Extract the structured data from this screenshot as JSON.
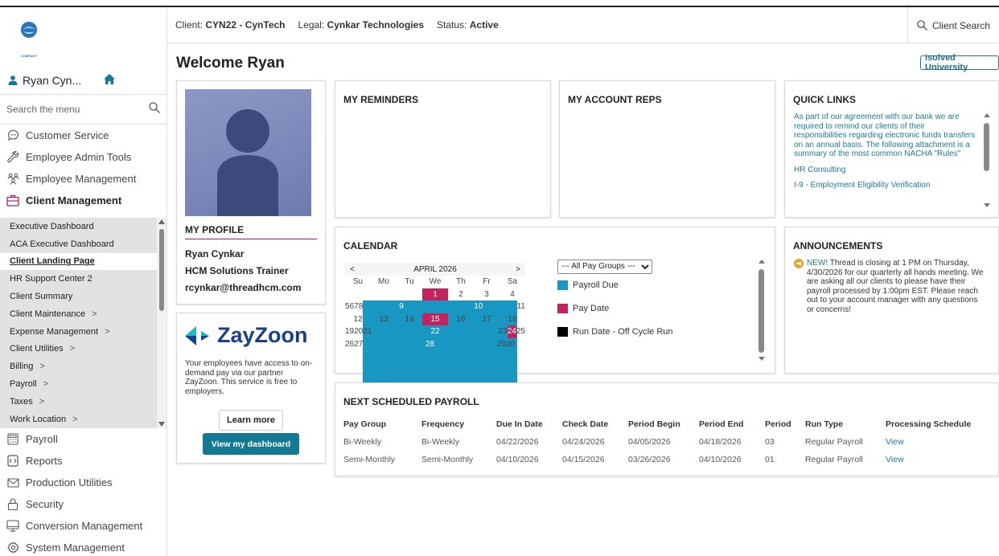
{
  "header": {
    "client_label": "Client:",
    "client_value": "CYN22 - CynTech",
    "legal_label": "Legal:",
    "legal_value": "Cynkar Technologies",
    "status_label": "Status:",
    "status_value": "Active",
    "client_search": "Client Search"
  },
  "sidebar": {
    "logo_text": "COMPANY",
    "user_name": "Ryan Cyn...",
    "search_placeholder": "Search the menu",
    "top_items": [
      {
        "label": "Customer Service",
        "icon": "chat-icon"
      },
      {
        "label": "Employee Admin Tools",
        "icon": "wrench-icon"
      },
      {
        "label": "Employee Management",
        "icon": "people-icon"
      },
      {
        "label": "Client Management",
        "icon": "briefcase-icon"
      }
    ],
    "sub_items": [
      {
        "label": "Executive Dashboard"
      },
      {
        "label": "ACA Executive Dashboard"
      },
      {
        "label": "Client Landing Page"
      },
      {
        "label": "HR Support Center 2"
      },
      {
        "label": "Client Summary"
      },
      {
        "label": "Client Maintenance",
        "chevron": ">"
      },
      {
        "label": "Expense Management",
        "chevron": ">"
      },
      {
        "label": "Client Utilities",
        "chevron": ">"
      },
      {
        "label": "Billing",
        "chevron": ">"
      },
      {
        "label": "Payroll",
        "chevron": ">"
      },
      {
        "label": "Taxes",
        "chevron": ">"
      },
      {
        "label": "Work Location",
        "chevron": ">"
      }
    ],
    "bottom_items": [
      {
        "label": "Payroll",
        "icon": "calculator-icon"
      },
      {
        "label": "Reports",
        "icon": "report-icon"
      },
      {
        "label": "Production Utilities",
        "icon": "mail-icon"
      },
      {
        "label": "Security",
        "icon": "lock-icon"
      },
      {
        "label": "Conversion Management",
        "icon": "monitor-icon"
      },
      {
        "label": "System Management",
        "icon": "gear-icon"
      }
    ]
  },
  "main": {
    "welcome": "Welcome Ryan",
    "university_button": "isolved University",
    "profile": {
      "title": "MY PROFILE",
      "name": "Ryan Cynkar",
      "role": "HCM Solutions Trainer",
      "email": "rcynkar@threadhcm.com"
    },
    "zayzoon": {
      "logo": "ZayZoon",
      "text": "Your employees have access to on-demand pay via our partner ZayZoon. This service is free to employers.",
      "learn_more": "Learn more",
      "dashboard": "View my dashboard"
    },
    "reminders_title": "MY REMINDERS",
    "reps_title": "MY ACCOUNT REPS",
    "quick_links": {
      "title": "QUICK LINKS",
      "items": [
        "As part of our agreement with our bank we are required to remind our clients of their responsibilities regarding electronic funds transfers on an annual basis. The following attachment is a summary of the most common NACHA \"Rules\"",
        "HR Consulting",
        "I-9 - Employment Eligibility Verification"
      ]
    },
    "calendar": {
      "title": "CALENDAR",
      "prev": "<",
      "next": ">",
      "month": "APRIL 2026",
      "days": [
        "Su",
        "Mo",
        "Tu",
        "We",
        "Th",
        "Fr",
        "Sa"
      ],
      "weeks": [
        [
          "",
          "",
          "",
          "1",
          "2",
          "3",
          "4"
        ],
        [
          "5",
          "6",
          "7",
          "8",
          "9",
          "10",
          "11"
        ],
        [
          "12",
          "13",
          "14",
          "15",
          "16",
          "17",
          "18"
        ],
        [
          "19",
          "20",
          "21",
          "22",
          "23",
          "24",
          "25"
        ],
        [
          "26",
          "27",
          "28",
          "29",
          "30",
          "",
          ""
        ]
      ],
      "payroll_due_days": [
        "9",
        "10",
        "22",
        "28"
      ],
      "pay_date_days": [
        "1",
        "15",
        "24"
      ],
      "select_value": "--- All Pay Groups ---",
      "legend": [
        {
          "label": "Payroll Due",
          "color": "#1897c2"
        },
        {
          "label": "Pay Date",
          "color": "#c4235f"
        },
        {
          "label": "Run Date - Off Cycle Run",
          "color": "#000000"
        }
      ]
    },
    "announcements": {
      "title": "ANNOUNCEMENTS",
      "new_label": "NEW!",
      "text": " Thread is closing at 1 PM on Thursday, 4/30/2026 for our quarterly all hands meeting. We are asking all our clients to please have their payroll processed by 1:00pm EST. Please reach out to your account manager with any questions or concerns!"
    },
    "payroll": {
      "title": "NEXT SCHEDULED PAYROLL",
      "columns": [
        "Pay Group",
        "Frequency",
        "Due In Date",
        "Check Date",
        "Period Begin",
        "Period End",
        "Period",
        "Run Type",
        "Processing Schedule"
      ],
      "rows": [
        [
          "Bi-Weekly",
          "Bi-Weekly",
          "04/22/2026",
          "04/24/2026",
          "04/05/2026",
          "04/18/2026",
          "03",
          "Regular Payroll",
          "View"
        ],
        [
          "Semi-Monthly",
          "Semi-Monthly",
          "04/10/2026",
          "04/15/2026",
          "03/26/2026",
          "04/10/2026",
          "01",
          "Regular Payroll",
          "View"
        ]
      ]
    }
  },
  "colors": {
    "accent": "#147a94",
    "link": "#1c7aa0",
    "magenta": "#c4235f",
    "payroll_blue": "#1897c2"
  }
}
